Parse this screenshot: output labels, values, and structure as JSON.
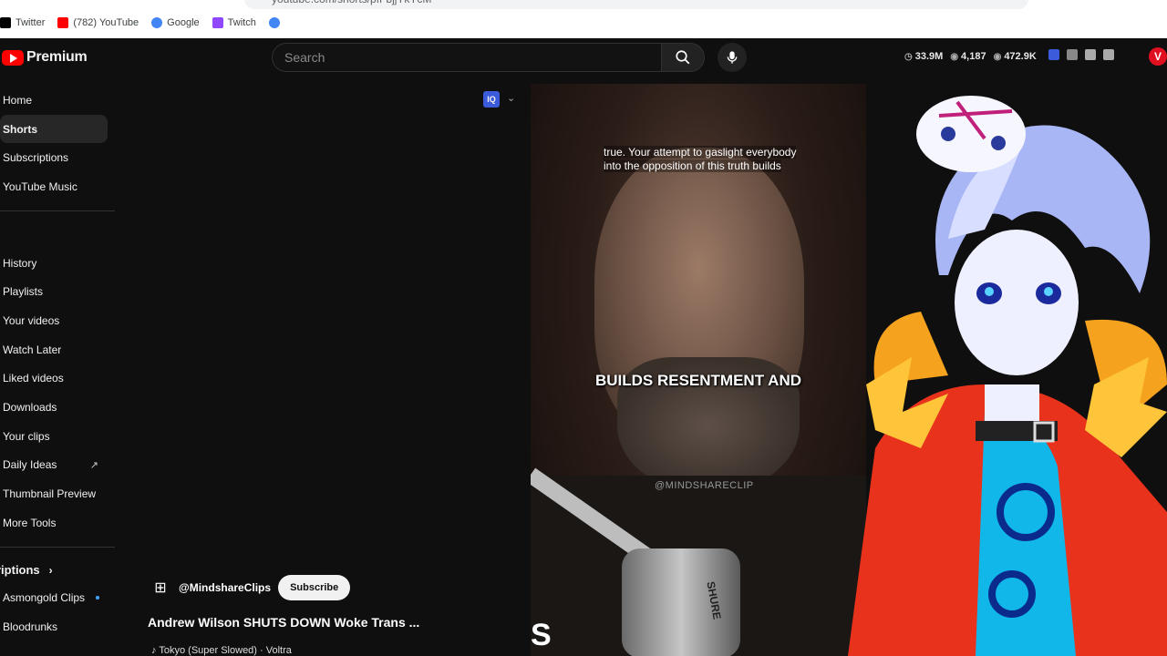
{
  "browser": {
    "url": "youtube.com/shorts/pfFbjjYkYcM",
    "bookmarks": [
      {
        "label": "Twitter",
        "icon": "twitter-icon",
        "color": "#000000"
      },
      {
        "label": "(782) YouTube",
        "icon": "youtube-icon",
        "color": "#ff0000"
      },
      {
        "label": "Google",
        "icon": "google-icon",
        "color": "#4285f4"
      },
      {
        "label": "Twitch",
        "icon": "twitch-icon",
        "color": "#9146ff"
      },
      {
        "label": "",
        "icon": "google-icon",
        "color": "#4285f4"
      }
    ]
  },
  "header": {
    "logo_text": "Premium",
    "search_placeholder": "Search",
    "stats": {
      "views": "33.9M",
      "count": "4,187",
      "watching": "472.9K"
    },
    "avatar_letter": "V"
  },
  "sidebar": {
    "items": [
      {
        "label": "Home",
        "active": false
      },
      {
        "label": "Shorts",
        "active": true
      },
      {
        "label": "Subscriptions",
        "active": false
      },
      {
        "label": "YouTube Music",
        "active": false
      }
    ],
    "library": [
      {
        "label": "History"
      },
      {
        "label": "Playlists"
      },
      {
        "label": "Your videos"
      },
      {
        "label": "Watch Later"
      },
      {
        "label": "Liked videos"
      },
      {
        "label": "Downloads"
      },
      {
        "label": "Your clips"
      },
      {
        "label": "Daily Ideas"
      },
      {
        "label": "Thumbnail Preview"
      },
      {
        "label": "More Tools"
      }
    ],
    "subscriptions_heading": "riptions",
    "subscriptions": [
      {
        "label": "Asmongold Clips"
      },
      {
        "label": "Bloodrunks"
      }
    ]
  },
  "extension": {
    "badge": "IQ"
  },
  "video": {
    "caption_top": "true. Your attempt to gaslight everybody into the opposition of this truth builds",
    "caption_main": "BUILDS RESENTMENT AND",
    "watermark": "@MINDSHARECLIP",
    "bottom_letter": "S",
    "mic_brand": "SHURE"
  },
  "channel": {
    "name": "@MindshareClips",
    "subscribe_label": "Subscribe",
    "title": "Andrew Wilson SHUTS DOWN Woke Trans ...",
    "music": "Tokyo (Super Slowed) · Voltra"
  }
}
